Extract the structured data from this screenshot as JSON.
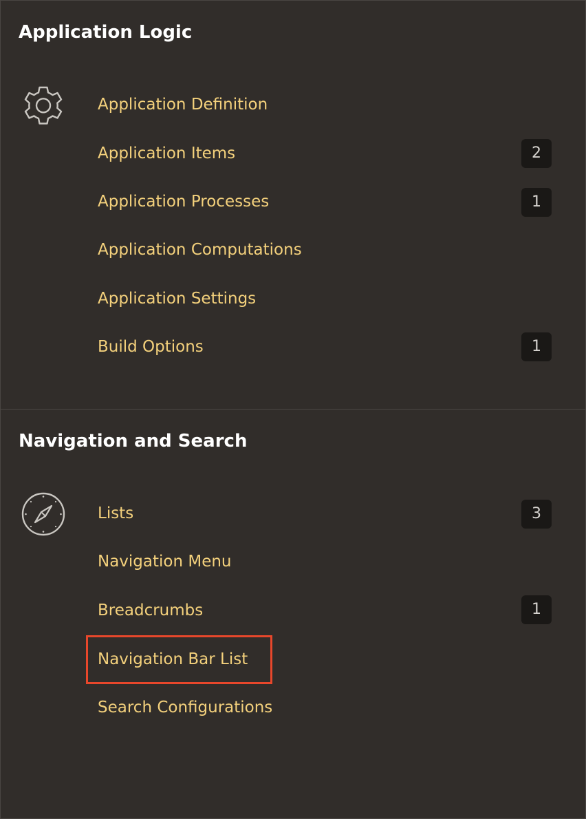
{
  "sections": [
    {
      "title": "Application Logic",
      "icon": "gear-icon",
      "items": [
        {
          "label": "Application Definition",
          "count": null
        },
        {
          "label": "Application Items",
          "count": "2"
        },
        {
          "label": "Application Processes",
          "count": "1"
        },
        {
          "label": "Application Computations",
          "count": null
        },
        {
          "label": "Application Settings",
          "count": null
        },
        {
          "label": "Build Options",
          "count": "1"
        }
      ]
    },
    {
      "title": "Navigation and Search",
      "icon": "compass-icon",
      "items": [
        {
          "label": "Lists",
          "count": "3"
        },
        {
          "label": "Navigation Menu",
          "count": null
        },
        {
          "label": "Breadcrumbs",
          "count": "1"
        },
        {
          "label": "Navigation Bar List",
          "count": null,
          "highlighted": true
        },
        {
          "label": "Search Configurations",
          "count": null
        }
      ]
    }
  ],
  "colors": {
    "background": "#312d2a",
    "link": "#f4d17c",
    "title": "#ffffff",
    "badge_bg": "#1a1816",
    "highlight_border": "#e8472b"
  }
}
